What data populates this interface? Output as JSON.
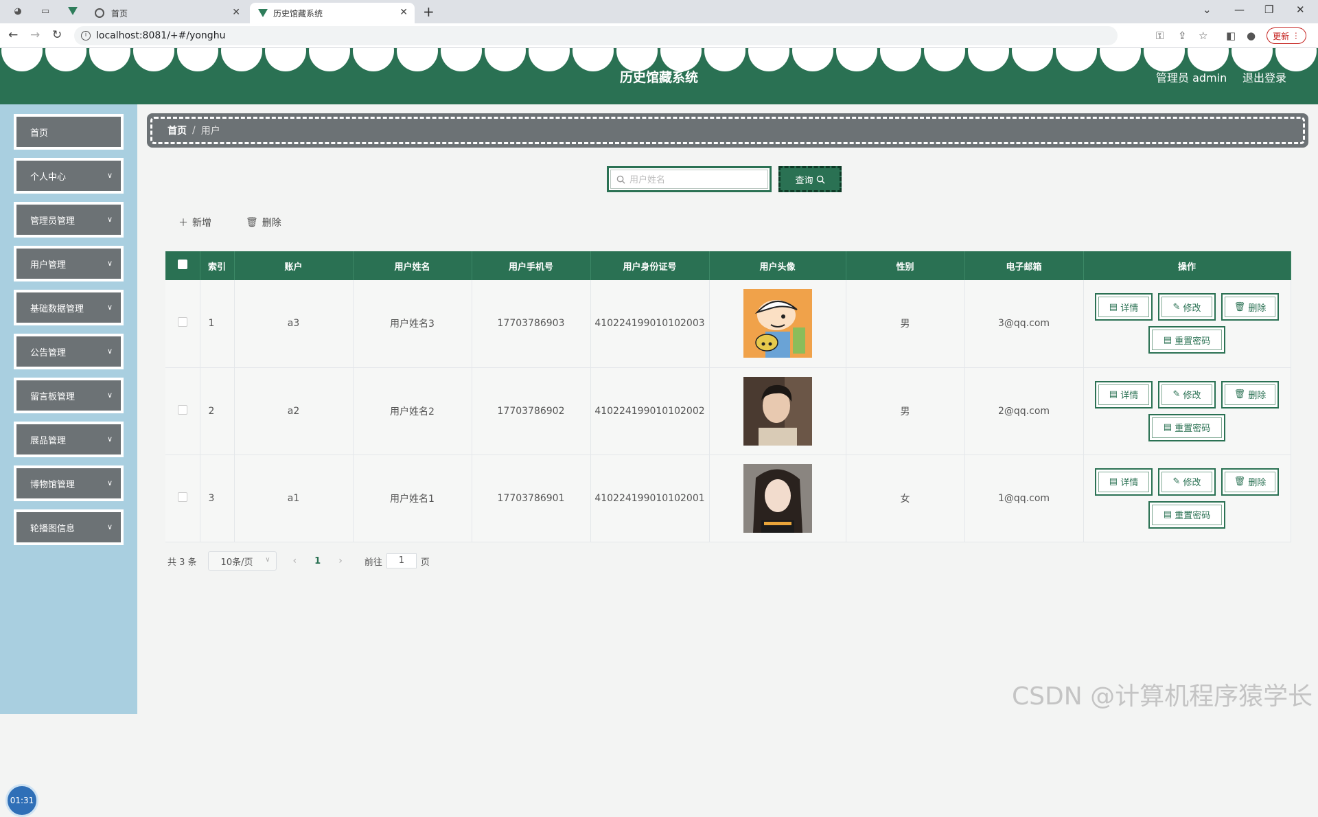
{
  "browser": {
    "tabs": [
      {
        "title": "首页"
      },
      {
        "title": "历史馆藏系统"
      }
    ],
    "url": "localhost:8081/+#/yonghu",
    "update_label": "更新"
  },
  "header": {
    "title": "历史馆藏系统",
    "admin_label": "管理员 admin",
    "logout_label": "退出登录"
  },
  "sidebar": {
    "items": [
      {
        "label": "首页"
      },
      {
        "label": "个人中心"
      },
      {
        "label": "管理员管理"
      },
      {
        "label": "用户管理"
      },
      {
        "label": "基础数据管理"
      },
      {
        "label": "公告管理"
      },
      {
        "label": "留言板管理"
      },
      {
        "label": "展品管理"
      },
      {
        "label": "博物馆管理"
      },
      {
        "label": "轮播图信息"
      }
    ],
    "timer": "01:31"
  },
  "breadcrumb": {
    "home": "首页",
    "sep": "/",
    "current": "用户"
  },
  "search": {
    "placeholder": "用户姓名",
    "button_label": "查询"
  },
  "actions": {
    "add_label": "新增",
    "delete_label": "删除"
  },
  "table": {
    "headers": [
      "索引",
      "账户",
      "用户姓名",
      "用户手机号",
      "用户身份证号",
      "用户头像",
      "性别",
      "电子邮箱",
      "操作"
    ],
    "rows": [
      {
        "index": "1",
        "account": "a3",
        "name": "用户姓名3",
        "phone": "17703786903",
        "id_card": "410224199010102003",
        "gender": "男",
        "email": "3@qq.com"
      },
      {
        "index": "2",
        "account": "a2",
        "name": "用户姓名2",
        "phone": "17703786902",
        "id_card": "410224199010102002",
        "gender": "男",
        "email": "2@qq.com"
      },
      {
        "index": "3",
        "account": "a1",
        "name": "用户姓名1",
        "phone": "17703786901",
        "id_card": "410224199010102001",
        "gender": "女",
        "email": "1@qq.com"
      }
    ],
    "ops": {
      "detail": "详情",
      "edit": "修改",
      "delete": "删除",
      "reset": "重置密码"
    }
  },
  "pagination": {
    "total": "共 3 条",
    "page_size": "10条/页",
    "current_page": "1",
    "goto_prefix": "前往",
    "goto_value": "1",
    "goto_suffix": "页"
  },
  "watermark": "CSDN @计算机程序猿学长",
  "colors": {
    "primary": "#2a7153",
    "sidebar_bg": "#a9cfe0",
    "menu_item": "#6c7275"
  }
}
